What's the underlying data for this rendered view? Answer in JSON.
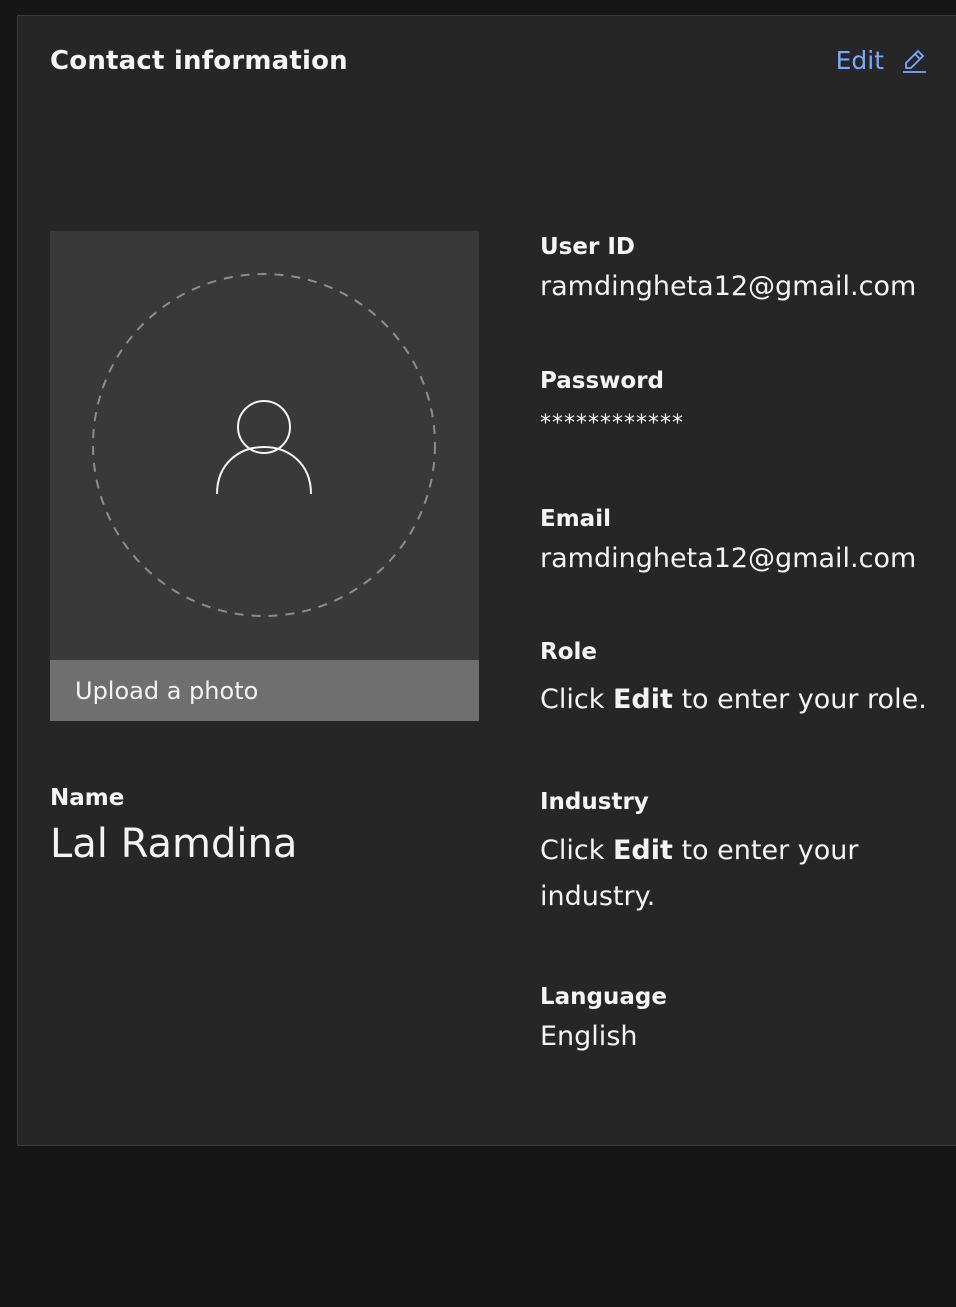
{
  "header": {
    "title": "Contact information",
    "edit_label": "Edit"
  },
  "photo": {
    "upload_label": "Upload a photo"
  },
  "name": {
    "label": "Name",
    "value": "Lal Ramdina"
  },
  "fields": {
    "user_id": {
      "label": "User ID",
      "value": "ramdingheta12@gmail.com"
    },
    "password": {
      "label": "Password",
      "value": "************"
    },
    "email": {
      "label": "Email",
      "value": "ramdingheta12@gmail.com"
    },
    "role": {
      "label": "Role",
      "prefix": "Click",
      "edit_word": "Edit",
      "suffix": "to enter your role."
    },
    "industry": {
      "label": "Industry",
      "prefix": "Click",
      "edit_word": "Edit",
      "suffix": "to enter your industry."
    },
    "language": {
      "label": "Language",
      "value": "English"
    }
  },
  "colors": {
    "background": "#161616",
    "card": "#262626",
    "link": "#78a9ff",
    "upload_bar": "#6f6f6f"
  },
  "icons": {
    "edit": "pencil-icon",
    "avatar": "user-avatar-icon"
  }
}
